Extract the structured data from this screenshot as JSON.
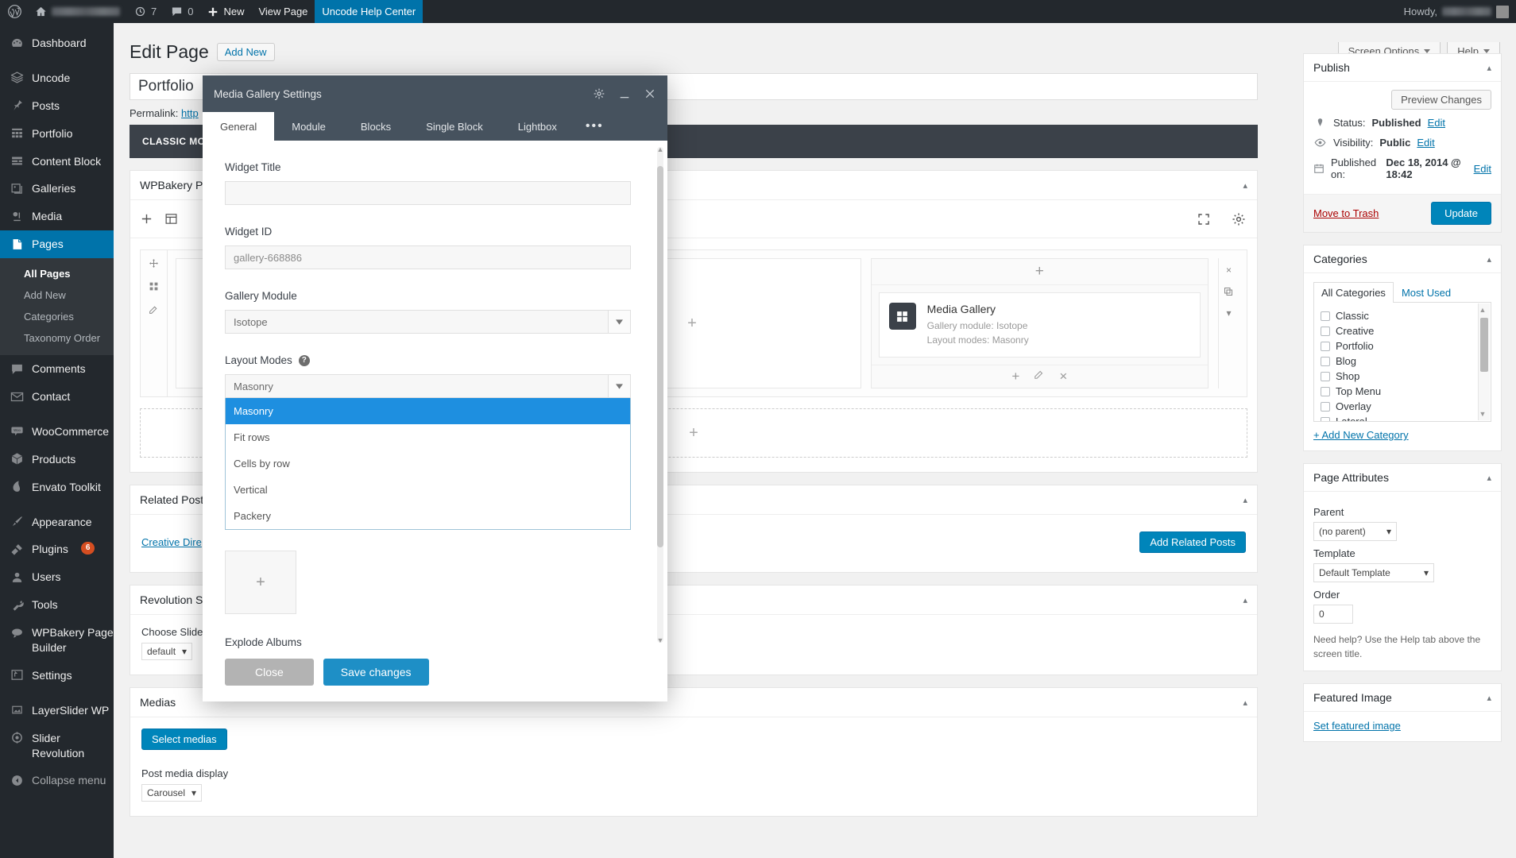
{
  "adminbar": {
    "wp_logo": "wordpress-logo",
    "site_name_blurred": true,
    "revisions_count": "7",
    "comments_count": "0",
    "new_label": "New",
    "view_page_label": "View Page",
    "help_center_label": "Uncode Help Center",
    "howdy_label": "Howdy,"
  },
  "sidebar": {
    "items": [
      {
        "label": "Dashboard",
        "icon": "dashboard-icon"
      },
      {
        "label": "Uncode",
        "icon": "layers-icon",
        "gap_before": true
      },
      {
        "label": "Posts",
        "icon": "pin-icon"
      },
      {
        "label": "Portfolio",
        "icon": "grid-icon"
      },
      {
        "label": "Content Block",
        "icon": "block-icon"
      },
      {
        "label": "Galleries",
        "icon": "gallery-icon"
      },
      {
        "label": "Media",
        "icon": "media-icon"
      },
      {
        "label": "Pages",
        "icon": "page-icon",
        "active": true
      },
      {
        "label": "Comments",
        "icon": "comment-icon",
        "gap_before": true
      },
      {
        "label": "Contact",
        "icon": "mail-icon"
      },
      {
        "label": "WooCommerce",
        "icon": "woo-icon",
        "gap_before": true
      },
      {
        "label": "Products",
        "icon": "product-icon"
      },
      {
        "label": "Envato Toolkit",
        "icon": "envato-icon"
      },
      {
        "label": "Appearance",
        "icon": "brush-icon",
        "gap_before": true
      },
      {
        "label": "Plugins",
        "icon": "plug-icon",
        "badge": "6"
      },
      {
        "label": "Users",
        "icon": "user-icon"
      },
      {
        "label": "Tools",
        "icon": "wrench-icon"
      },
      {
        "label": "WPBakery Page Builder",
        "icon": "wpbakery-icon"
      },
      {
        "label": "Settings",
        "icon": "settings-icon"
      },
      {
        "label": "LayerSlider WP",
        "icon": "layerslider-icon",
        "gap_before": true
      },
      {
        "label": "Slider Revolution",
        "icon": "sliderrev-icon"
      },
      {
        "label": "Collapse menu",
        "icon": "collapse-icon",
        "dim": true
      }
    ],
    "submenu": [
      {
        "label": "All Pages",
        "current": true
      },
      {
        "label": "Add New"
      },
      {
        "label": "Categories"
      },
      {
        "label": "Taxonomy Order"
      }
    ]
  },
  "screen_meta": {
    "screen_options": "Screen Options",
    "help": "Help"
  },
  "page": {
    "title": "Edit Page",
    "add_new": "Add New",
    "post_title": "Portfolio",
    "permalink_label": "Permalink:",
    "permalink_value": "http",
    "classic_bar": "CLASSIC MODE"
  },
  "vc_box": {
    "heading": "WPBakery Page Builder",
    "toggle": "▴",
    "element": {
      "title": "Media Gallery",
      "line1": "Gallery module: Isotope",
      "line2": "Layout modes: Masonry",
      "icon": "gallery-grid-icon"
    }
  },
  "related_posts": {
    "heading": "Related Posts",
    "link": "Creative Dire",
    "add_button": "Add Related Posts"
  },
  "revolution": {
    "heading": "Revolution Slider",
    "label": "Choose Slide Te",
    "value": "default"
  },
  "medias": {
    "heading": "Medias",
    "select_button": "Select medias",
    "display_label": "Post media display",
    "display_value": "Carousel"
  },
  "publish": {
    "heading": "Publish",
    "preview_changes": "Preview Changes",
    "status_label": "Status:",
    "status_value": "Published",
    "visibility_label": "Visibility:",
    "visibility_value": "Public",
    "published_label": "Published on:",
    "published_value": "Dec 18, 2014 @ 18:42",
    "edit_link": "Edit",
    "move_to_trash": "Move to Trash",
    "update_button": "Update"
  },
  "categories": {
    "heading": "Categories",
    "tab_all": "All Categories",
    "tab_most_used": "Most Used",
    "items": [
      "Classic",
      "Creative",
      "Portfolio",
      "Blog",
      "Shop",
      "Top Menu",
      "Overlay",
      "Lateral"
    ],
    "add_new": "+ Add New Category"
  },
  "page_attributes": {
    "heading": "Page Attributes",
    "parent_label": "Parent",
    "parent_value": "(no parent)",
    "template_label": "Template",
    "template_value": "Default Template",
    "order_label": "Order",
    "order_value": "0",
    "help_note": "Need help? Use the Help tab above the screen title."
  },
  "featured_image": {
    "heading": "Featured Image",
    "set_link": "Set featured image"
  },
  "modal": {
    "title": "Media Gallery Settings",
    "gear_icon": "gear-icon",
    "minimize_icon": "minimize-icon",
    "close_icon": "close-icon",
    "tabs": [
      {
        "label": "General",
        "active": true
      },
      {
        "label": "Module"
      },
      {
        "label": "Blocks"
      },
      {
        "label": "Single Block"
      },
      {
        "label": "Lightbox"
      },
      {
        "label": "•••",
        "is_dots": true
      }
    ],
    "fields": {
      "widget_title_label": "Widget Title",
      "widget_title_value": "",
      "widget_id_label": "Widget ID",
      "widget_id_value": "gallery-668886",
      "gallery_module_label": "Gallery Module",
      "gallery_module_value": "Isotope",
      "layout_modes_label": "Layout Modes",
      "layout_modes_value": "Masonry",
      "layout_modes_options": [
        "Masonry",
        "Fit rows",
        "Cells by row",
        "Vertical",
        "Packery"
      ],
      "layout_modes_selected": "Masonry",
      "explode_albums_label": "Explode Albums"
    },
    "footer": {
      "close_label": "Close",
      "save_label": "Save changes"
    }
  },
  "colors": {
    "wp_blue": "#0073aa",
    "accent_blue": "#1e8fe0",
    "sidebar_dark": "#23282d",
    "modal_header": "#46525e",
    "badge_orange": "#d54e21"
  }
}
